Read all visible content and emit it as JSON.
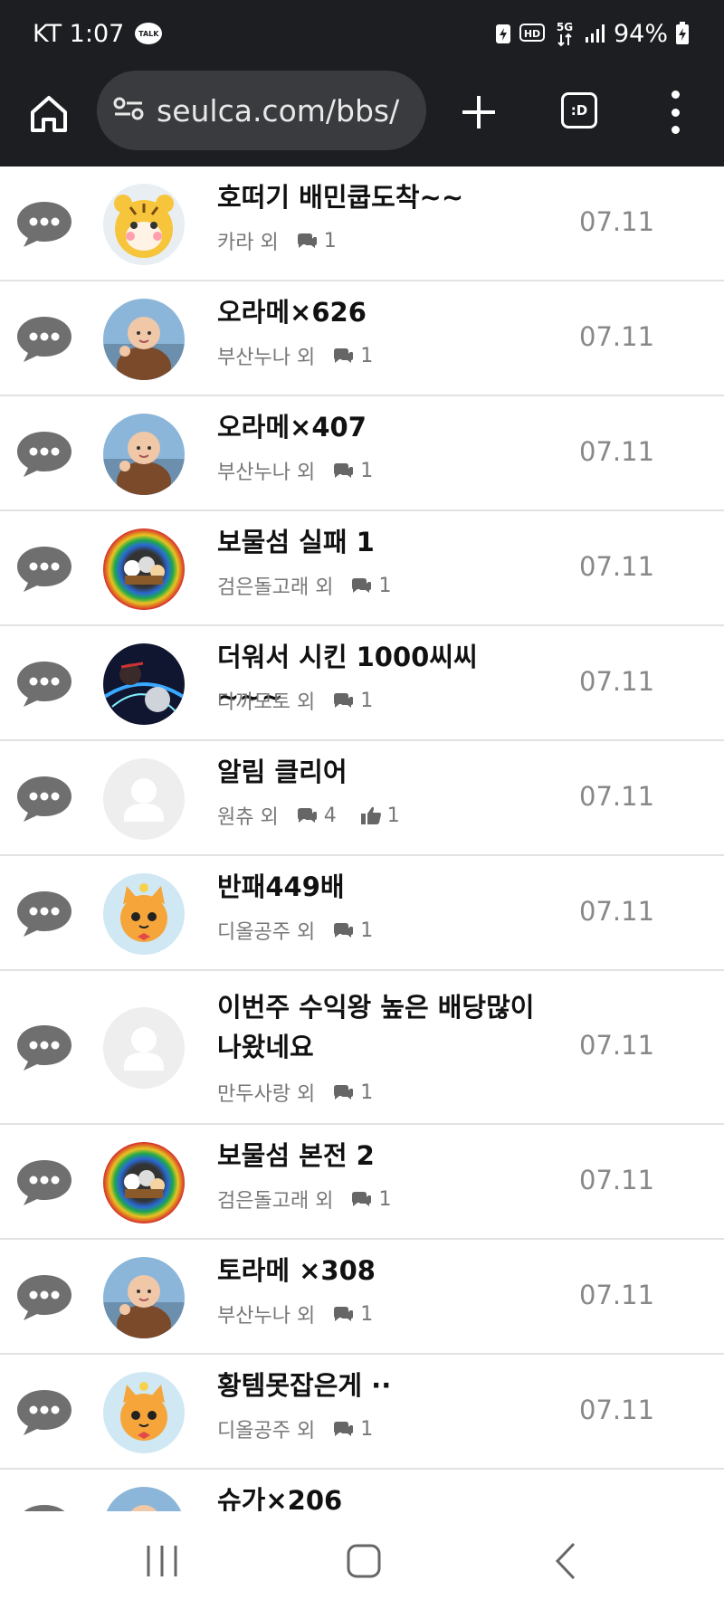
{
  "status_bar": {
    "carrier_time": "KT 1:07",
    "talk_badge": "TALK",
    "hd_badge": "HD",
    "net_badge": "5G",
    "battery": "94%"
  },
  "browser": {
    "url": "seulca.com/bbs/",
    "tabs_label": ":D"
  },
  "posts": [
    {
      "title": "호떠기 배민쿱도착~~",
      "author": "카라 외",
      "comments": "1",
      "likes": null,
      "date": "07.11",
      "avatar": "tiger"
    },
    {
      "title": "오라메×626",
      "author": "부산누나 외",
      "comments": "1",
      "likes": null,
      "date": "07.11",
      "avatar": "monk"
    },
    {
      "title": "오라메×407",
      "author": "부산누나 외",
      "comments": "1",
      "likes": null,
      "date": "07.11",
      "avatar": "monk"
    },
    {
      "title": "보물섬 실패 1",
      "author": "검은돌고래 외",
      "comments": "1",
      "likes": null,
      "date": "07.11",
      "avatar": "rainbow"
    },
    {
      "title": "더워서 시킨 1000씨씨 ~~~",
      "author": "다까모토 외",
      "comments": "1",
      "likes": null,
      "date": "07.11",
      "avatar": "anime"
    },
    {
      "title": "알림 클리어",
      "author": "원츄 외",
      "comments": "4",
      "likes": "1",
      "date": "07.11",
      "avatar": "default"
    },
    {
      "title": "반패449배",
      "author": "디올공주 외",
      "comments": "1",
      "likes": null,
      "date": "07.11",
      "avatar": "cat"
    },
    {
      "title": "이번주 수익왕 높은 배당많이 나왔네요",
      "author": "만두사랑 외",
      "comments": "1",
      "likes": null,
      "date": "07.11",
      "avatar": "default"
    },
    {
      "title": "보물섬 본전 2",
      "author": "검은돌고래 외",
      "comments": "1",
      "likes": null,
      "date": "07.11",
      "avatar": "rainbow"
    },
    {
      "title": "토라메 ×308",
      "author": "부산누나 외",
      "comments": "1",
      "likes": null,
      "date": "07.11",
      "avatar": "monk"
    },
    {
      "title": "황템못잡은게 ··",
      "author": "디올공주 외",
      "comments": "1",
      "likes": null,
      "date": "07.11",
      "avatar": "cat"
    },
    {
      "title": "슈가×206",
      "author": "",
      "comments": "",
      "likes": null,
      "date": "",
      "avatar": "monk"
    }
  ],
  "icons": {
    "row_chat": "chat-bubble-icon",
    "comment": "comments-icon",
    "like": "thumbs-up-icon",
    "nav": [
      "recents-icon",
      "home-icon",
      "back-icon"
    ]
  },
  "colors": {
    "dark_bar": "#1d1e22",
    "divider": "#e2e2e2",
    "chat_icon": "#6f6f6f",
    "date": "#888888"
  }
}
